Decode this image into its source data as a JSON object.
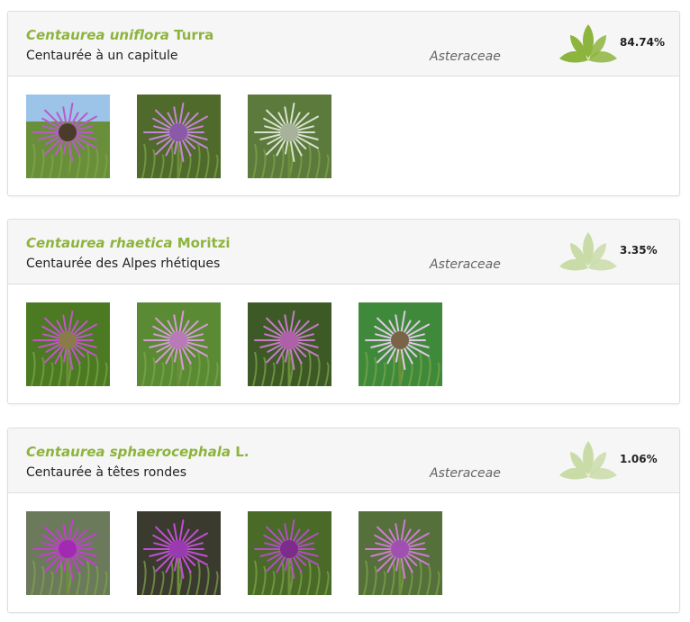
{
  "results": [
    {
      "genus_species": "Centaurea uniflora",
      "author": "Turra",
      "common_name": "Centaurée à un capitule",
      "family": "Asteraceae",
      "score": "84.74%",
      "score_level": 0.8474,
      "icon_color": "#8db43c",
      "images": [
        {
          "name": "flower-photo-1",
          "bg": "#6a8f3a",
          "petal": "#b85bc9",
          "center": "#4a3b2a",
          "sky": true
        },
        {
          "name": "flower-photo-2",
          "bg": "#4f6a2a",
          "petal": "#c585d8",
          "center": "#8a5aa8",
          "sky": false
        },
        {
          "name": "flower-photo-3",
          "bg": "#5c7a3c",
          "petal": "#d9e0d0",
          "center": "#a8b29a",
          "sky": false
        }
      ]
    },
    {
      "genus_species": "Centaurea rhaetica",
      "author": "Moritzi",
      "common_name": "Centaurée des Alpes rhétiques",
      "family": "Asteraceae",
      "score": "3.35%",
      "score_level": 0.0335,
      "icon_color": "#c9dca8",
      "images": [
        {
          "name": "flower-photo-1",
          "bg": "#4b7a22",
          "petal": "#c255c9",
          "center": "#8b7a4a",
          "sky": false
        },
        {
          "name": "flower-photo-2",
          "bg": "#5a8a34",
          "petal": "#d69ad6",
          "center": "#b97ab8",
          "sky": false
        },
        {
          "name": "flower-photo-3",
          "bg": "#3d5a26",
          "petal": "#c87ac9",
          "center": "#b060a8",
          "sky": false
        },
        {
          "name": "flower-photo-4",
          "bg": "#3f8a3a",
          "petal": "#e2c8e6",
          "center": "#7a6448",
          "sky": false
        }
      ]
    },
    {
      "genus_species": "Centaurea sphaerocephala",
      "author": "L.",
      "common_name": "Centaurée à têtes rondes",
      "family": "Asteraceae",
      "score": "1.06%",
      "score_level": 0.0106,
      "icon_color": "#c9dca8",
      "images": [
        {
          "name": "flower-photo-1",
          "bg": "#6a7a5a",
          "petal": "#c43fd0",
          "center": "#a22ab2",
          "sky": false
        },
        {
          "name": "flower-photo-2",
          "bg": "#3a3a2e",
          "petal": "#c050d2",
          "center": "#9a3ab0",
          "sky": false
        },
        {
          "name": "flower-photo-3",
          "bg": "#4a6a28",
          "petal": "#b34ec4",
          "center": "#7c2c8a",
          "sky": false
        },
        {
          "name": "flower-photo-4",
          "bg": "#55703a",
          "petal": "#d07ad6",
          "center": "#a050b0",
          "sky": false
        }
      ]
    }
  ]
}
